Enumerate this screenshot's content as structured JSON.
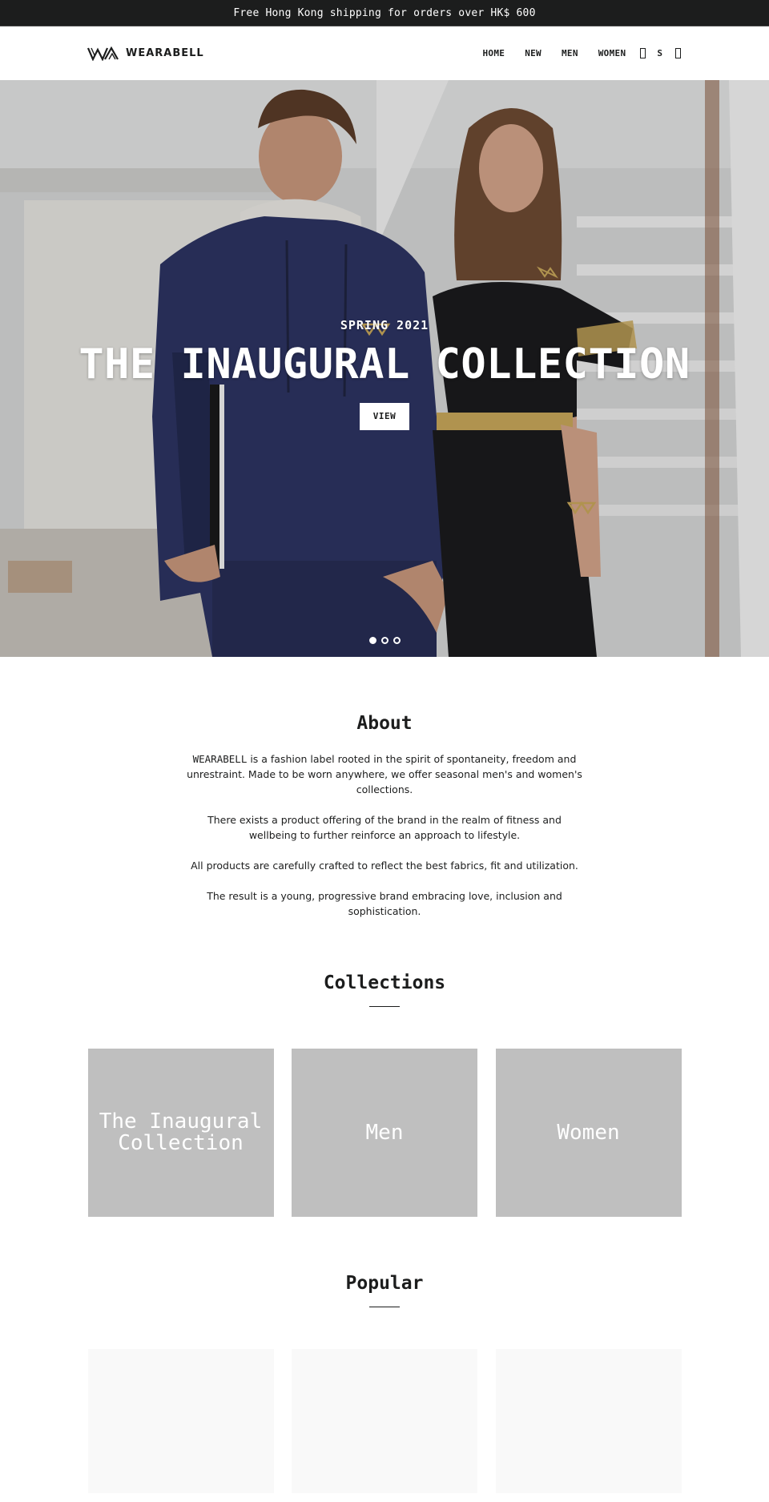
{
  "announcement": {
    "text": "Free Hong Kong shipping for orders over HK$ 600"
  },
  "header": {
    "brand": "WEARABELL",
    "nav": [
      {
        "label": "HOME"
      },
      {
        "label": "NEW"
      },
      {
        "label": "MEN"
      },
      {
        "label": "WOMEN"
      }
    ],
    "icons": {
      "search": "search-icon",
      "account": "account-icon",
      "cart": "cart-icon"
    },
    "currency_label": "S"
  },
  "hero": {
    "subtitle": "SPRING 2021",
    "title": "THE INAUGURAL COLLECTION",
    "button_label": "VIEW",
    "slides_total": 3,
    "active_slide": 1,
    "colors": {
      "navy": "#2d3462",
      "black": "#1b1b1d",
      "gold": "#c9a85a",
      "background": "#d9dada"
    }
  },
  "about": {
    "title": "About",
    "brand_word": "WEARABELL",
    "paragraphs": [
      " is a fashion label rooted in the spirit of spontaneity, freedom and unrestraint. Made to be worn anywhere, we offer seasonal men's and women's collections.",
      "There exists a product offering of the brand in the realm of fitness and wellbeing to further reinforce an approach to lifestyle.",
      "All products are carefully crafted to reflect the best fabrics, fit and utilization.",
      "The result is a young, progressive brand embracing love, inclusion and sophistication."
    ]
  },
  "collections": {
    "title": "Collections",
    "items": [
      {
        "label": "The Inaugural Collection"
      },
      {
        "label": "Men"
      },
      {
        "label": "Women"
      }
    ]
  },
  "popular": {
    "title": "Popular",
    "items": [
      {},
      {},
      {}
    ]
  }
}
